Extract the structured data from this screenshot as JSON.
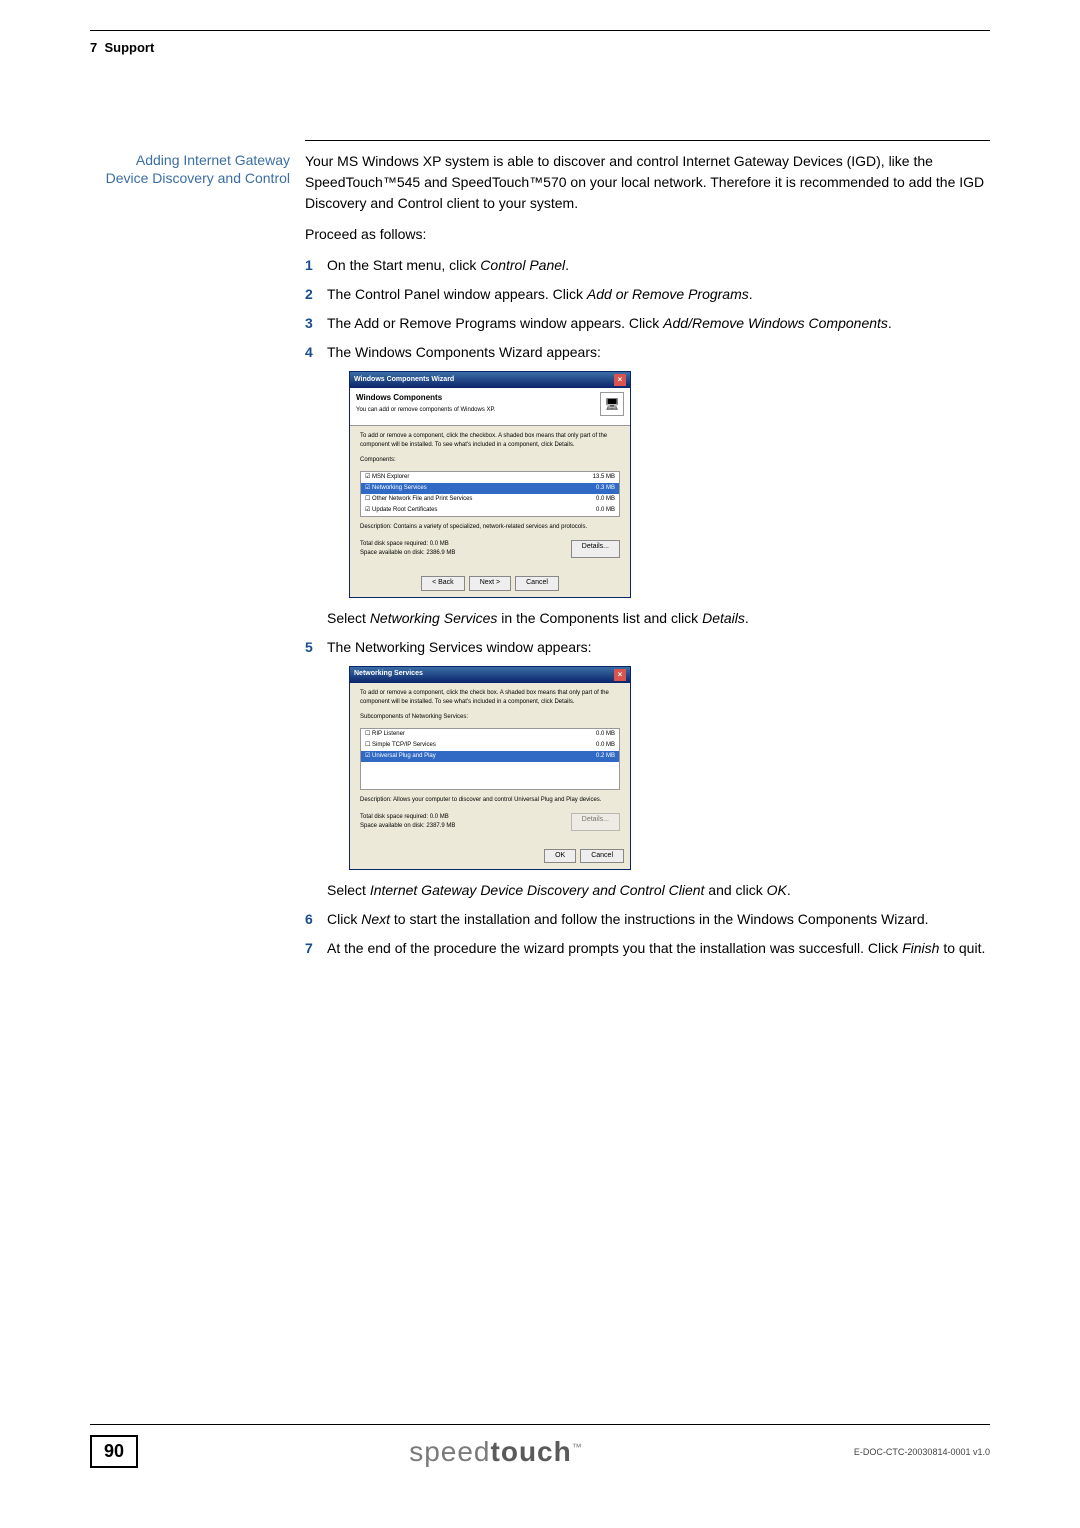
{
  "header": {
    "chapter": "7",
    "title": "Support"
  },
  "section_heading": "Adding Internet Gateway Device Discovery and Control",
  "intro": "Your MS Windows XP system is able to discover and control Internet Gateway Devices (IGD), like the SpeedTouch™545 and SpeedTouch™570 on your local network. Therefore it is recommended to add the IGD Discovery and Control client to your system.",
  "proceed": "Proceed as follows:",
  "steps": {
    "s1": {
      "pre": "On the Start menu, click ",
      "it": "Control Panel",
      "post": "."
    },
    "s2": {
      "pre": "The Control Panel window appears. Click ",
      "it": "Add or Remove Programs",
      "post": "."
    },
    "s3": {
      "pre": "The Add or Remove Programs window appears. Click ",
      "it": "Add/Remove Windows Components",
      "post": "."
    },
    "s4": "The Windows Components Wizard appears:",
    "s4_after_pre": "Select ",
    "s4_after_it": "Networking Services",
    "s4_after_mid": " in the Components list and click ",
    "s4_after_it2": "Details",
    "s4_after_post": ".",
    "s5": "The Networking Services window appears:",
    "s5_after_pre": "Select ",
    "s5_after_it": "Internet Gateway Device Discovery and Control Client",
    "s5_after_mid": " and click ",
    "s5_after_it2": "OK",
    "s5_after_post": ".",
    "s6_pre": "Click ",
    "s6_it": "Next",
    "s6_post": " to start the installation and follow the instructions in the Windows Components Wizard.",
    "s7_pre": "At the end of the procedure the wizard prompts you that the installation was succesfull. Click ",
    "s7_it": "Finish",
    "s7_post": " to quit."
  },
  "wizard1": {
    "title": "Windows Components Wizard",
    "heading": "Windows Components",
    "sub": "You can add or remove components of Windows XP.",
    "instr": "To add or remove a component, click the checkbox. A shaded box means that only part of the component will be installed. To see what's included in a component, click Details.",
    "label_components": "Components:",
    "rows": [
      {
        "name": "MSN Explorer",
        "size": "13.5 MB"
      },
      {
        "name": "Networking Services",
        "size": "0.3 MB"
      },
      {
        "name": "Other Network File and Print Services",
        "size": "0.0 MB"
      },
      {
        "name": "Update Root Certificates",
        "size": "0.0 MB"
      }
    ],
    "desc_label": "Description:",
    "desc": "Contains a variety of specialized, network-related services and protocols.",
    "disk_req_label": "Total disk space required:",
    "disk_req": "0.0 MB",
    "disk_avail_label": "Space available on disk:",
    "disk_avail": "2386.9 MB",
    "btn_details": "Details...",
    "btn_back": "< Back",
    "btn_next": "Next >",
    "btn_cancel": "Cancel"
  },
  "wizard2": {
    "title": "Networking Services",
    "instr": "To add or remove a component, click the check box. A shaded box means that only part of the component will be installed. To see what's included in a component, click Details.",
    "label_sub": "Subcomponents of Networking Services:",
    "rows": [
      {
        "name": "RIP Listener",
        "size": "0.0 MB"
      },
      {
        "name": "Simple TCP/IP Services",
        "size": "0.0 MB"
      },
      {
        "name": "Universal Plug and Play",
        "size": "0.2 MB"
      }
    ],
    "desc_label": "Description:",
    "desc": "Allows your computer to discover and control Universal Plug and Play devices.",
    "disk_req_label": "Total disk space required:",
    "disk_req": "0.0 MB",
    "disk_avail_label": "Space available on disk:",
    "disk_avail": "2387.9 MB",
    "btn_details": "Details...",
    "btn_ok": "OK",
    "btn_cancel": "Cancel"
  },
  "footer": {
    "page": "90",
    "brand_light": "speed",
    "brand_bold": "touch",
    "docid": "E-DOC-CTC-20030814-0001 v1.0"
  }
}
